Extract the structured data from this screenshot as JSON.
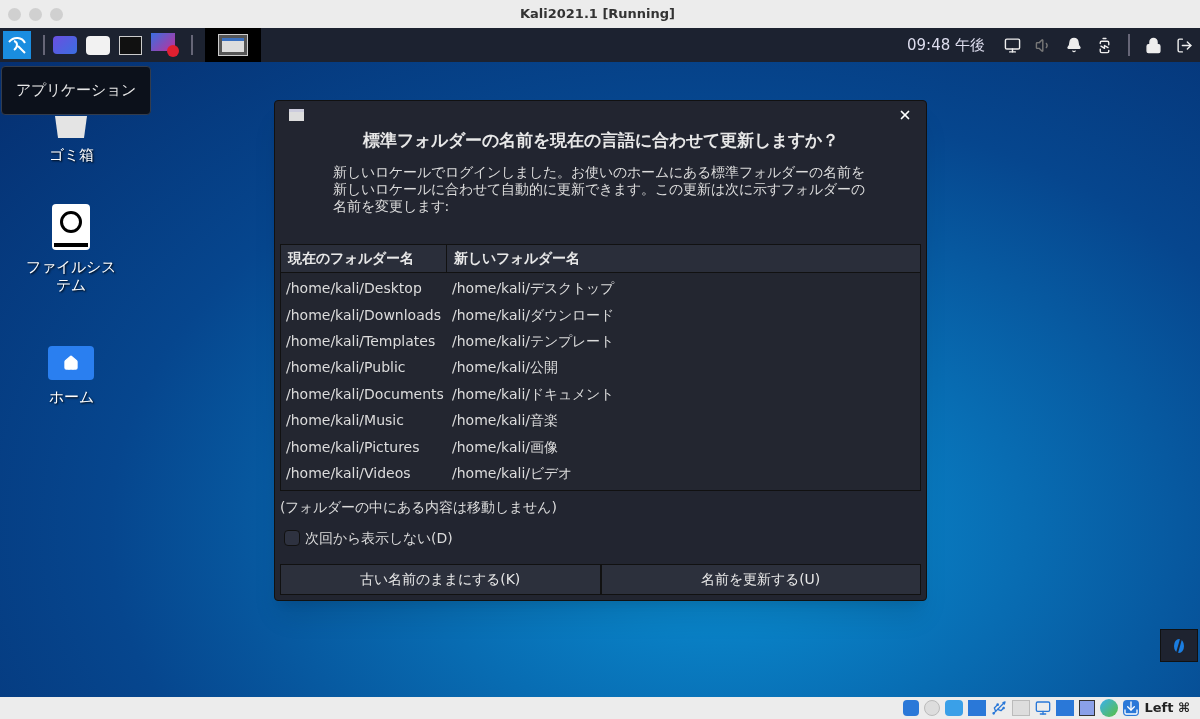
{
  "window": {
    "title": "Kali2021.1 [Running]"
  },
  "panel": {
    "clock": "09:48 午後",
    "tooltip": "アプリケーション"
  },
  "desktop_icons": [
    {
      "kind": "trash",
      "label": "ゴミ箱"
    },
    {
      "kind": "drive",
      "label": "ファイルシステム"
    },
    {
      "kind": "home",
      "label": "ホーム"
    }
  ],
  "dialog": {
    "title": "標準フォルダーの名前を現在の言語に合わせて更新しますか？",
    "message": "新しいロケールでログインしました。お使いのホームにある標準フォルダーの名前を新しいロケールに合わせて自動的に更新できます。この更新は次に示すフォルダーの名前を変更します:",
    "columns": [
      "現在のフォルダー名",
      "新しいフォルダー名"
    ],
    "rows": [
      {
        "current": "/home/kali/Desktop",
        "new": "/home/kali/デスクトップ"
      },
      {
        "current": "/home/kali/Downloads",
        "new": "/home/kali/ダウンロード"
      },
      {
        "current": "/home/kali/Templates",
        "new": "/home/kali/テンプレート"
      },
      {
        "current": "/home/kali/Public",
        "new": "/home/kali/公開"
      },
      {
        "current": "/home/kali/Documents",
        "new": "/home/kali/ドキュメント"
      },
      {
        "current": "/home/kali/Music",
        "new": "/home/kali/音楽"
      },
      {
        "current": "/home/kali/Pictures",
        "new": "/home/kali/画像"
      },
      {
        "current": "/home/kali/Videos",
        "new": "/home/kali/ビデオ"
      }
    ],
    "note": "(フォルダーの中にある内容は移動しません)",
    "dont_show": {
      "label": "次回から表示しない(D)",
      "checked": false
    },
    "buttons": [
      "古い名前のままにする(K)",
      "名前を更新する(U)"
    ]
  },
  "status_bar": {
    "host_key": "Left ⌘"
  }
}
